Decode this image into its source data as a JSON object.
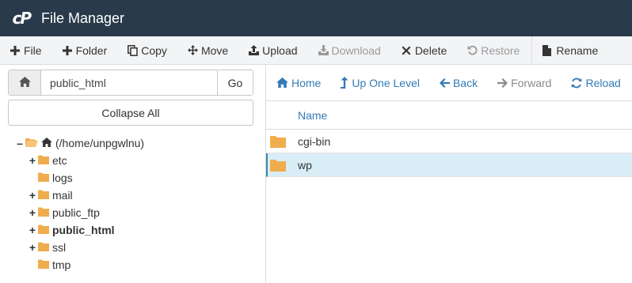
{
  "app": {
    "logo_text": "cP",
    "title": "File Manager"
  },
  "colors": {
    "titlebar": "#293a4a",
    "accent": "#337ab7",
    "folder": "#f0ad4e",
    "selected_row": "#d9edf7"
  },
  "toolbar": {
    "file": "File",
    "folder": "Folder",
    "copy": "Copy",
    "move": "Move",
    "upload": "Upload",
    "download": "Download",
    "delete": "Delete",
    "restore": "Restore",
    "rename": "Rename"
  },
  "address": {
    "value": "public_html",
    "go_label": "Go"
  },
  "collapse_label": "Collapse All",
  "tree": {
    "root_label": "(/home/unpgwlnu)",
    "items": [
      {
        "label": "etc",
        "toggle": "+",
        "bold": false
      },
      {
        "label": "logs",
        "toggle": "",
        "bold": false
      },
      {
        "label": "mail",
        "toggle": "+",
        "bold": false
      },
      {
        "label": "public_ftp",
        "toggle": "+",
        "bold": false
      },
      {
        "label": "public_html",
        "toggle": "+",
        "bold": true
      },
      {
        "label": "ssl",
        "toggle": "+",
        "bold": false
      },
      {
        "label": "tmp",
        "toggle": "",
        "bold": false
      }
    ]
  },
  "nav": {
    "home": "Home",
    "up": "Up One Level",
    "back": "Back",
    "forward": "Forward",
    "reload": "Reload"
  },
  "table": {
    "header_name": "Name",
    "rows": [
      {
        "name": "cgi-bin",
        "selected": false
      },
      {
        "name": "wp",
        "selected": true
      }
    ]
  },
  "icons": {
    "file": "plus-icon",
    "folder": "plus-icon",
    "copy": "copy-icon",
    "move": "move-icon",
    "upload": "upload-icon",
    "download": "download-icon",
    "delete": "x-icon",
    "restore": "undo-icon",
    "rename": "file-icon",
    "home": "home-icon",
    "up": "level-up-icon",
    "back": "arrow-left-icon",
    "forward": "arrow-right-icon",
    "reload": "refresh-icon"
  }
}
